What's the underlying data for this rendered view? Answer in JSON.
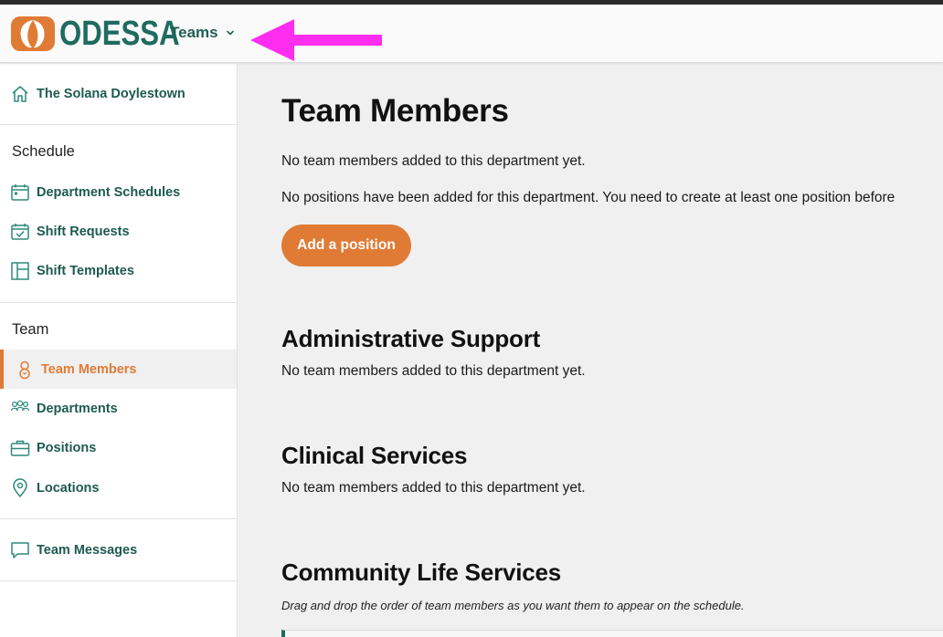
{
  "header": {
    "logo_text": "ODESSA",
    "teams_label": "Teams",
    "brand_color": "#1f6b5f",
    "accent_color": "#e07b35",
    "annotation_arrow_color": "#ff2df0"
  },
  "sidebar": {
    "location": "The Solana Doylestown",
    "sections": {
      "schedule": "Schedule",
      "team": "Team"
    },
    "items": {
      "department_schedules": "Department Schedules",
      "shift_requests": "Shift Requests",
      "shift_templates": "Shift Templates",
      "team_members": "Team Members",
      "departments": "Departments",
      "positions": "Positions",
      "locations": "Locations",
      "team_messages": "Team Messages"
    },
    "icons": {
      "location": "home-icon",
      "department_schedules": "calendar-icon",
      "shift_requests": "calendar-check-icon",
      "shift_templates": "layout-icon",
      "team_members": "person-icon",
      "departments": "group-icon",
      "positions": "briefcase-icon",
      "locations": "map-pin-icon",
      "team_messages": "chat-bubble-icon"
    }
  },
  "main": {
    "title": "Team Members",
    "no_members_msg": "No team members added to this department yet.",
    "no_positions_msg": "No positions have been added for this department. You need to create at least one position before",
    "add_position_label": "Add a position",
    "departments": [
      {
        "name": "Administrative Support",
        "message": "No team members added to this department yet."
      },
      {
        "name": "Clinical Services",
        "message": "No team members added to this department yet."
      },
      {
        "name": "Community Life Services",
        "message": "Drag and drop the order of team members as you want them to appear on the schedule."
      }
    ]
  }
}
